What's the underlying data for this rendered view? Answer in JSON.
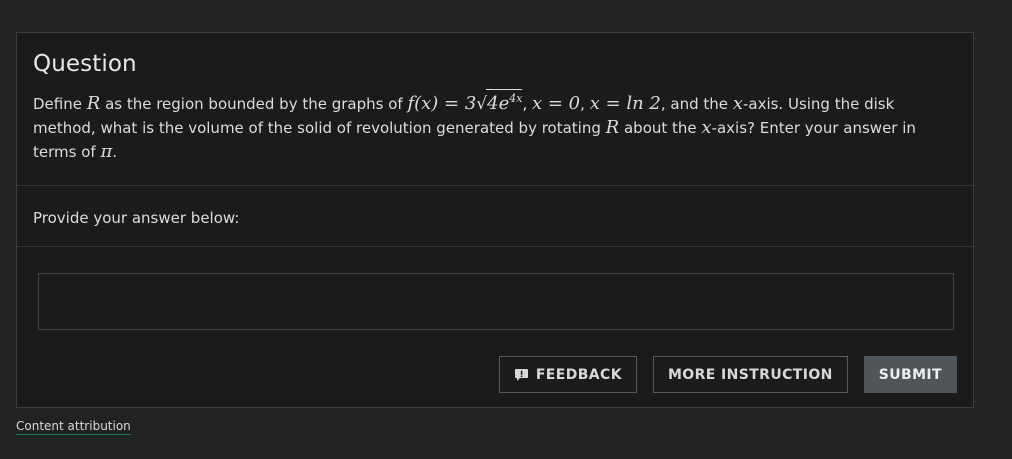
{
  "question": {
    "title": "Question",
    "text": {
      "p1": "Define ",
      "R": "R",
      "p2": " as the region bounded by the graphs of ",
      "fx": "f(x) = 3",
      "radicand": "4e",
      "exponent": "4x",
      "p3": ", ",
      "x0": "x = 0",
      "p4": ", ",
      "xln": "x = ln 2",
      "p5": ", and the ",
      "xaxis1": "x",
      "p6": "-axis. Using the disk method, what is the volume of the solid of revolution generated by rotating ",
      "R2": "R",
      "p7": " about the ",
      "xaxis2": "x",
      "p8": "-axis? Enter your answer in terms of ",
      "pi": "π",
      "p9": "."
    }
  },
  "answer": {
    "prompt": "Provide your answer below:",
    "value": "",
    "placeholder": ""
  },
  "buttons": {
    "feedback": "FEEDBACK",
    "more_instruction": "MORE INSTRUCTION",
    "submit": "SUBMIT"
  },
  "icons": {
    "feedback": "feedback-icon"
  },
  "footer": {
    "attribution": "Content attribution"
  },
  "colors": {
    "background": "#222222",
    "card": "#1b1b1b",
    "submit": "#4f5558",
    "attribution_underline": "#1b7a5a"
  }
}
